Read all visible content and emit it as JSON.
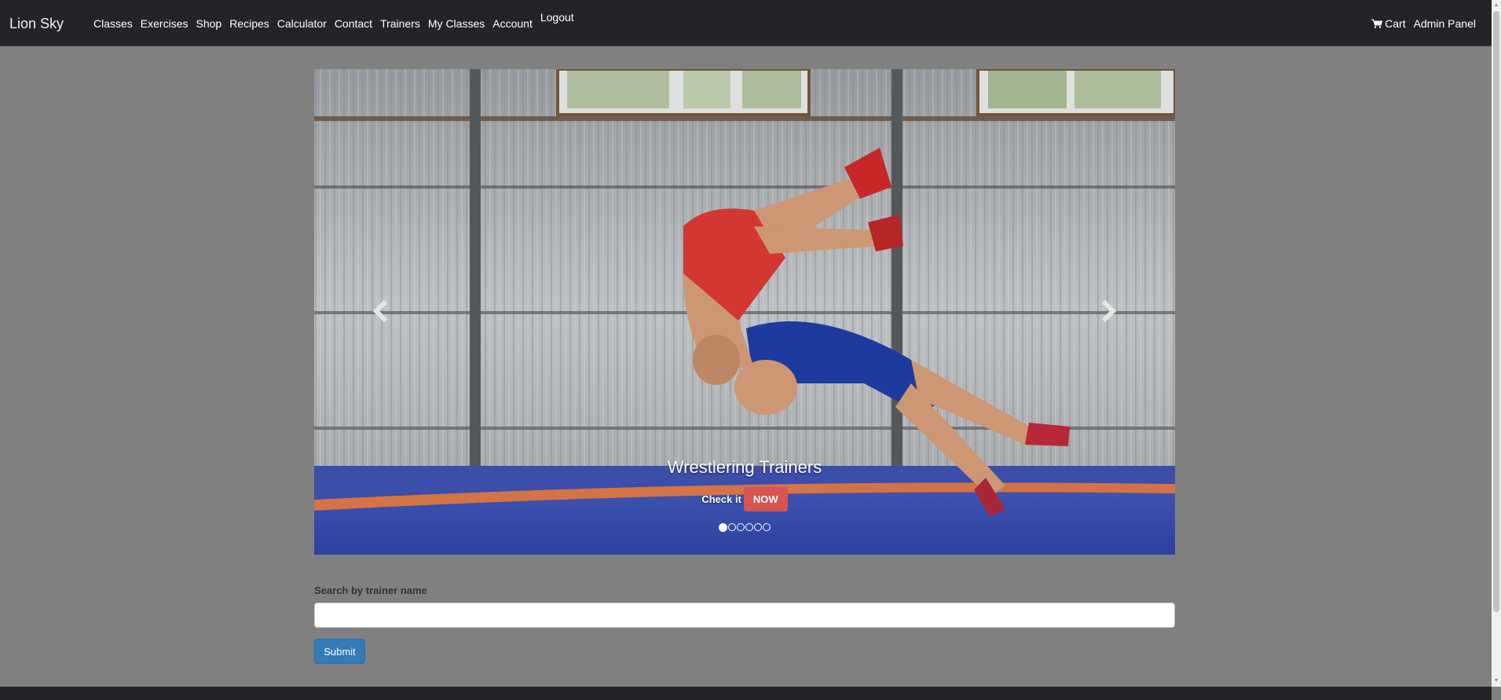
{
  "navbar": {
    "brand": "Lion Sky",
    "links": [
      "Classes",
      "Exercises",
      "Shop",
      "Recipes",
      "Calculator",
      "Contact",
      "Trainers",
      "My Classes",
      "Account",
      "Logout"
    ],
    "right": {
      "cart": "Cart",
      "admin": "Admin Panel"
    },
    "cart_icon": "shopping-cart-icon"
  },
  "carousel": {
    "caption_title": "Wrestlering Trainers",
    "caption_text": "Check it",
    "cta_label": "NOW",
    "slide_count": 6,
    "active_slide": 1,
    "prev_icon": "chevron-left-icon",
    "next_icon": "chevron-right-icon"
  },
  "search": {
    "label": "Search by trainer name",
    "value": "",
    "placeholder": "",
    "submit_label": "Submit"
  },
  "colors": {
    "page_background": "#808080",
    "navbar": "#222428",
    "primary": "#337ab7",
    "danger": "#d9534f"
  }
}
